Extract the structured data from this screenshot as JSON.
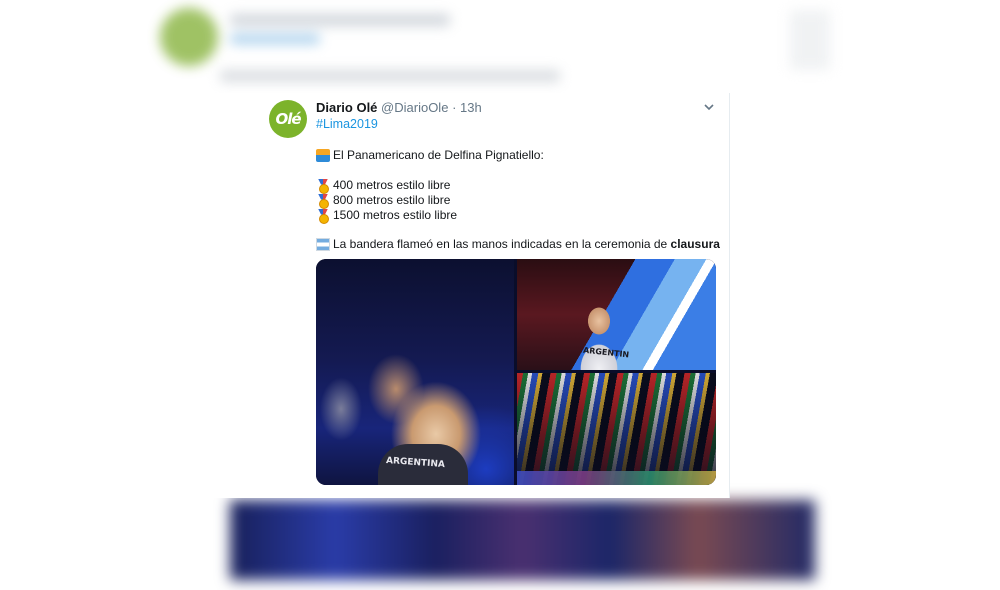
{
  "tweet": {
    "display_name": "Diario Olé",
    "handle": "@DiarioOle",
    "separator": "·",
    "time": "13h",
    "hashtag": "#Lima2019",
    "avatar_logo_text": "Olé",
    "lines": [
      {
        "icon": "swimmer-icon",
        "text": "El Panamericano de Delfina Pignatiello:"
      },
      {
        "icon": "medal-icon",
        "text": "400 metros estilo libre"
      },
      {
        "icon": "medal-icon",
        "text": "800 metros estilo libre"
      },
      {
        "icon": "medal-icon",
        "text": "1500 metros estilo libre"
      }
    ],
    "flag_line": {
      "icon": "argentina-flag-icon",
      "text": "La bandera flameó en las manos indicadas en la ceremonia de ",
      "bold_text": "clausura"
    },
    "photos": {
      "left_jacket_text": "ARGENTINA",
      "top_right_jacket_text": "ARGENTIN"
    }
  }
}
